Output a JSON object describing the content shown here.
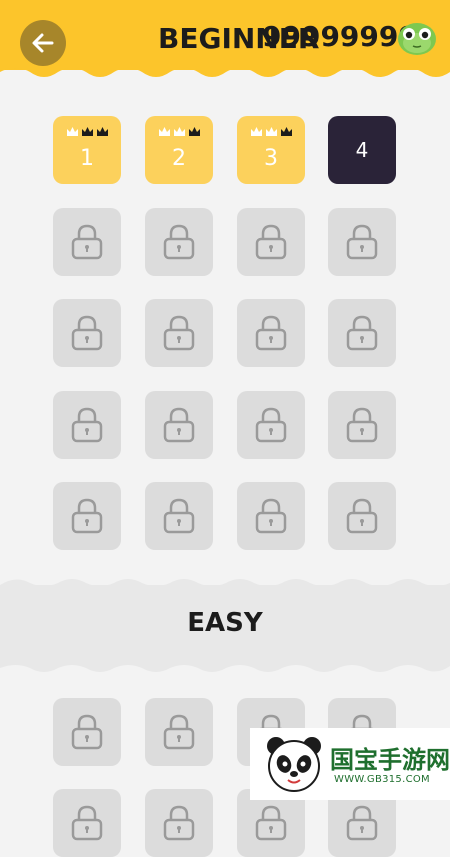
{
  "header": {
    "title": "BEGINNER",
    "coins": "99999999",
    "back_icon": "arrow-left-icon",
    "colors": {
      "bar": "#fcc52b",
      "back": "#a7862a"
    }
  },
  "levels": [
    {
      "label": "1",
      "state": "completed",
      "crowns": [
        true,
        false,
        false
      ]
    },
    {
      "label": "2",
      "state": "completed",
      "crowns": [
        true,
        true,
        false
      ]
    },
    {
      "label": "3",
      "state": "completed",
      "crowns": [
        true,
        true,
        false
      ]
    },
    {
      "label": "4",
      "state": "current"
    }
  ],
  "locked_icon": "lock-icon",
  "section": {
    "title": "EASY"
  },
  "watermark": {
    "main": "国宝手游网",
    "sub": "WWW.GB315.COM"
  }
}
